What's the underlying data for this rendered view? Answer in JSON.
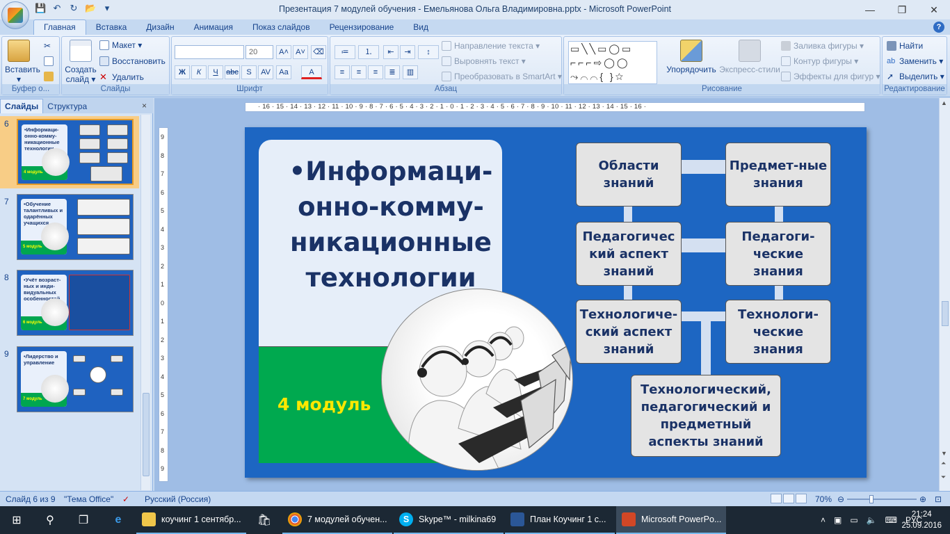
{
  "window": {
    "title": "Презентация 7 модулей обучения - Емельянова Ольга Владимировна.pptx - Microsoft PowerPoint"
  },
  "ribbon": {
    "tabs": [
      "Главная",
      "Вставка",
      "Дизайн",
      "Анимация",
      "Показ слайдов",
      "Рецензирование",
      "Вид"
    ],
    "groups": {
      "clipboard": {
        "label": "Буфер о...",
        "paste": "Вставить",
        "paste_sub": "▾"
      },
      "slides": {
        "label": "Слайды",
        "create": "Создать",
        "create2": "слайд ▾",
        "layout": "Макет ▾",
        "reset": "Восстановить",
        "delete": "Удалить"
      },
      "font": {
        "label": "Шрифт",
        "font_size": "20"
      },
      "paragraph": {
        "label": "Абзац",
        "text_direction": "Направление текста ▾",
        "align_text": "Выровнять текст ▾",
        "smartart": "Преобразовать в SmartArt ▾"
      },
      "drawing": {
        "label": "Рисование",
        "arrange": "Упорядочить",
        "quick_styles": "Экспресс-стили",
        "fill": "Заливка фигуры ▾",
        "outline": "Контур фигуры ▾",
        "effects": "Эффекты для фигур ▾"
      },
      "editing": {
        "label": "Редактирование",
        "find": "Найти",
        "replace": "Заменить ▾",
        "select": "Выделить ▾"
      }
    }
  },
  "left_pane": {
    "tabs": [
      "Слайды",
      "Структура"
    ],
    "close": "×",
    "slides": [
      {
        "num": "6",
        "title": "•Информаци-онно-комму-никационные технологии",
        "module": "4 модуль"
      },
      {
        "num": "7",
        "title": "•Обучение талантливых и одарённых учащихся",
        "module": "5 модуль"
      },
      {
        "num": "8",
        "title": "•Учёт возраст-ных и инди-видуальных особенностей",
        "module": "6 модуль"
      },
      {
        "num": "9",
        "title": "•Лидерство и управление",
        "module": "7 модуль"
      }
    ]
  },
  "ruler": {
    "h": "· 16 · 15 · 14 · 13 · 12 · 11 · 10 · 9 · 8 · 7 · 6 · 5 · 4 · 3 · 2 · 1 · 0 · 1 · 2 · 3 · 4 · 5 · 6 · 7 · 8 · 9 · 10 · 11 · 12 · 13 · 14 · 15 · 16 ·",
    "v": [
      "9",
      "8",
      "7",
      "6",
      "5",
      "4",
      "3",
      "2",
      "1",
      "0",
      "1",
      "2",
      "3",
      "4",
      "5",
      "6",
      "7",
      "8",
      "9"
    ]
  },
  "slide": {
    "title": "•Информаци-онно-комму-никационные технологии",
    "module": "4 модуль",
    "boxes": {
      "areas": "Области знаний",
      "subject": "Предмет-ные знания",
      "ped_aspect": "Педагогичес кий аспект знаний",
      "ped_knowledge": "Педагоги-ческие знания",
      "tech_aspect": "Технологиче-ский аспект знаний",
      "tech_knowledge": "Технологи-ческие знания",
      "combined": "Технологический, педагогический и предметный аспекты знаний"
    }
  },
  "statusbar": {
    "slide_info": "Слайд 6 из 9",
    "theme": "\"Тема Office\"",
    "language": "Русский (Россия)",
    "zoom": "70%"
  },
  "taskbar": {
    "items": [
      "коучинг 1 сентябр...",
      "7 модулей обучен...",
      "Skype™ - milkina69",
      "План Коучинг  1 с...",
      "Microsoft PowerPo..."
    ],
    "lang": "РУС",
    "time": "21:24",
    "date": "25.09.2016"
  },
  "colors": {
    "slide_bg": "#1d66c2",
    "green": "#00a94f",
    "module_text": "#ffe800",
    "title_text": "#1a3266"
  }
}
